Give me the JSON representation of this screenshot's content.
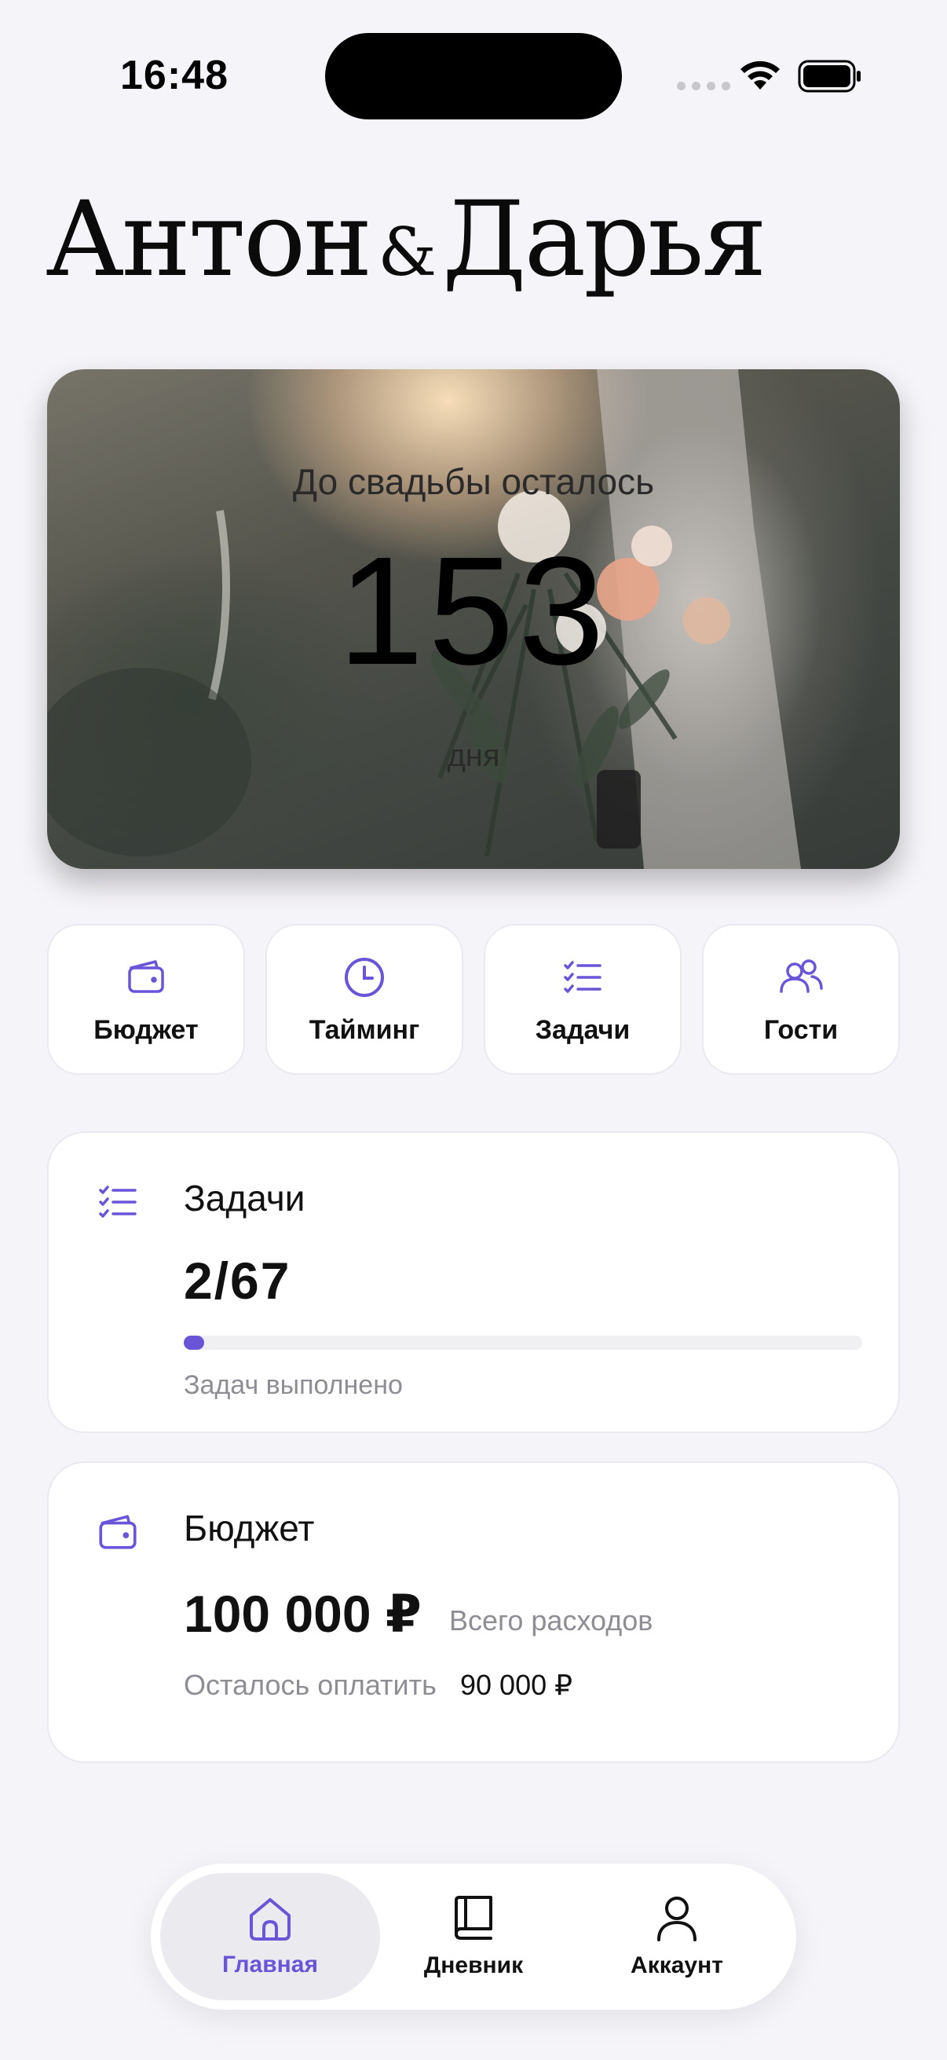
{
  "status_bar": {
    "time": "16:48"
  },
  "title": {
    "name1": "Антон",
    "amp": "&",
    "name2": "Дарья"
  },
  "hero": {
    "caption": "До свадьбы осталось",
    "days": "153",
    "unit": "дня"
  },
  "quick_actions": [
    {
      "label": "Бюджет",
      "icon": "wallet-icon"
    },
    {
      "label": "Тайминг",
      "icon": "clock-icon"
    },
    {
      "label": "Задачи",
      "icon": "checklist-icon"
    },
    {
      "label": "Гости",
      "icon": "people-icon"
    }
  ],
  "tasks_card": {
    "title": "Задачи",
    "count": "2/67",
    "done": 2,
    "total": 67,
    "caption": "Задач выполнено"
  },
  "budget_card": {
    "title": "Бюджет",
    "total": "100 000 ₽",
    "total_label": "Всего расходов",
    "remaining_label": "Осталось оплатить",
    "remaining_value": "90 000 ₽"
  },
  "tabbar": {
    "home": "Главная",
    "diary": "Дневник",
    "account": "Аккаунт",
    "active": "home"
  },
  "colors": {
    "accent": "#6a55d8",
    "background": "#f5f4f8",
    "muted_text": "#8e8d94"
  }
}
